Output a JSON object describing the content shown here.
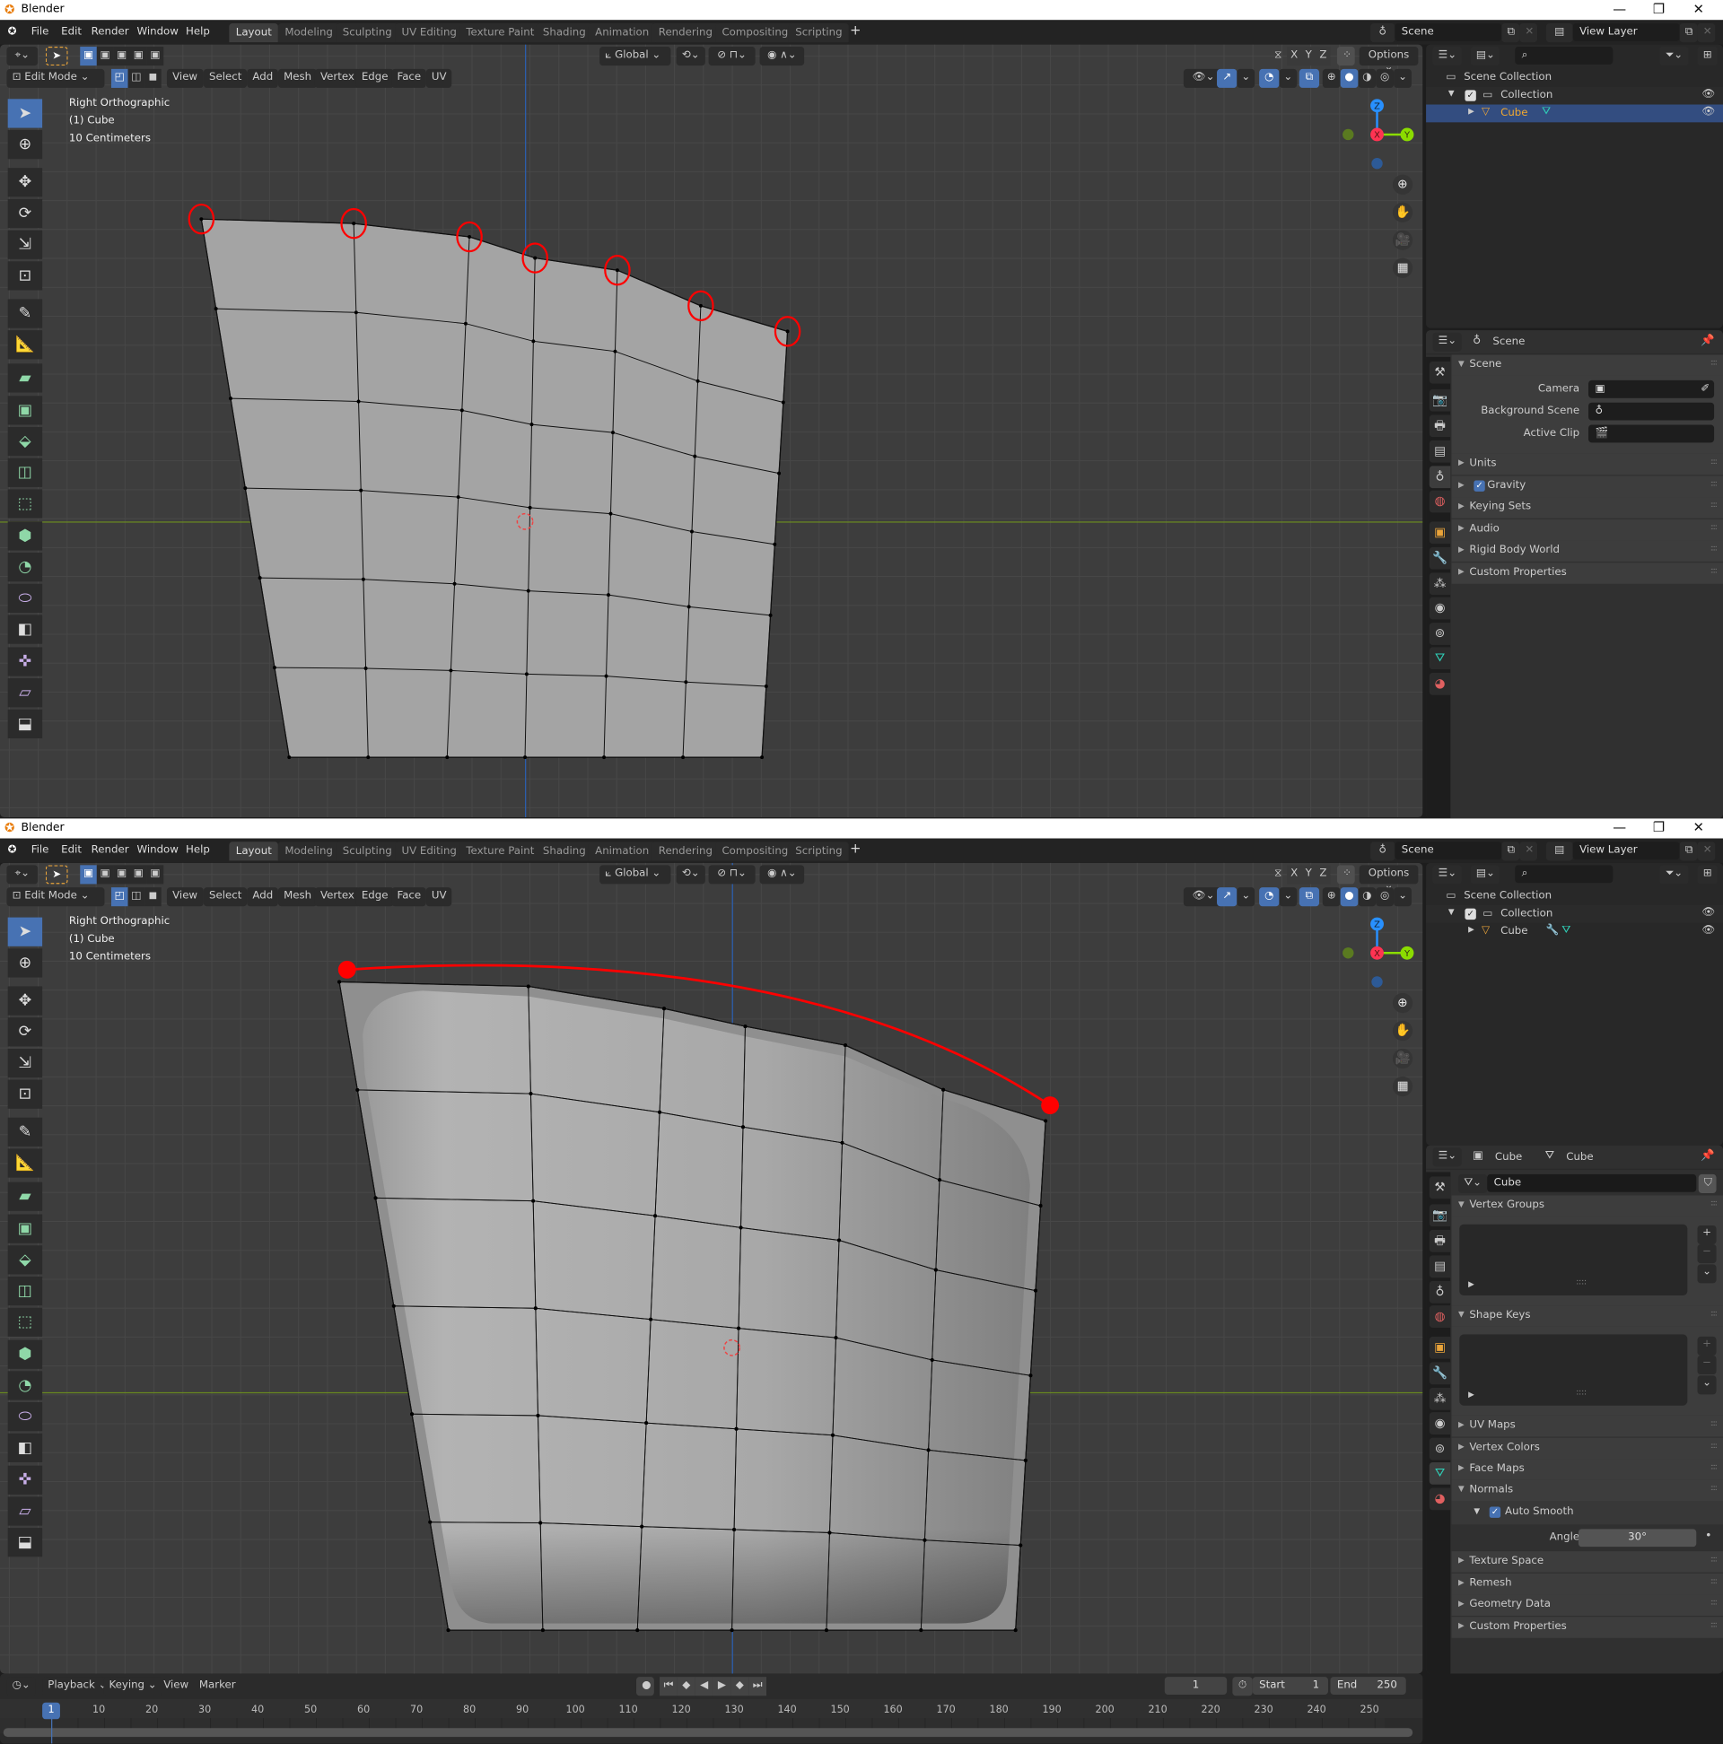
{
  "app": {
    "title": "Blender",
    "logo": "blender-logo"
  },
  "menus": [
    "File",
    "Edit",
    "Render",
    "Window",
    "Help"
  ],
  "workspaces": [
    "Layout",
    "Modeling",
    "Sculpting",
    "UV Editing",
    "Texture Paint",
    "Shading",
    "Animation",
    "Rendering",
    "Compositing",
    "Scripting"
  ],
  "active_workspace": "Layout",
  "scene_name": "Scene",
  "view_layer": "View Layer",
  "tool_header": {
    "orientation": "Global",
    "axes": [
      "X",
      "Y",
      "Z"
    ],
    "options": "Options"
  },
  "edit_header": {
    "mode": "Edit Mode",
    "menus": [
      "View",
      "Select",
      "Add",
      "Mesh",
      "Vertex",
      "Edge",
      "Face",
      "UV"
    ]
  },
  "viewport": {
    "view": "Right Orthographic",
    "object": "(1) Cube",
    "scale": "10 Centimeters"
  },
  "gizmo": {
    "z": "Z",
    "x": "X",
    "y": "Y"
  },
  "outliner": {
    "root": "Scene Collection",
    "collection": "Collection",
    "object": "Cube"
  },
  "colors": {
    "accent": "#4772b3",
    "annotation": "#ff0000",
    "object": "#e8a33a",
    "x_axis": "#ff3352",
    "y_axis": "#8bdc00",
    "z_axis": "#2890ff"
  },
  "windows": [
    {
      "properties": {
        "header": "Scene",
        "panel": "Scene",
        "fields": [
          {
            "label": "Camera"
          },
          {
            "label": "Background Scene"
          },
          {
            "label": "Active Clip"
          }
        ],
        "collapsed": [
          "Units",
          "Gravity",
          "Keying Sets",
          "Audio",
          "Rigid Body World",
          "Custom Properties"
        ],
        "gravity_checked": true
      },
      "annotation": "circled-vertices"
    },
    {
      "properties": {
        "header_object": "Cube",
        "header_mesh": "Cube",
        "datablock": "Cube",
        "vertex_groups": "Vertex Groups",
        "shape_keys": "Shape Keys",
        "collapsed": [
          "UV Maps",
          "Vertex Colors",
          "Face Maps"
        ],
        "normals": "Normals",
        "auto_smooth": "Auto Smooth",
        "auto_smooth_checked": true,
        "angle_label": "Angle",
        "angle_value": "30°",
        "collapsed2": [
          "Texture Space",
          "Remesh",
          "Geometry Data",
          "Custom Properties"
        ]
      },
      "annotation": "arc-between-vertices"
    }
  ],
  "timeline": {
    "menus": [
      "Playback",
      "Keying",
      "View",
      "Marker"
    ],
    "current_frame": "1",
    "start_label": "Start",
    "start": "1",
    "end_label": "End",
    "end": "250",
    "ticks": [
      "1",
      "10",
      "20",
      "30",
      "40",
      "50",
      "60",
      "70",
      "80",
      "90",
      "100",
      "110",
      "120",
      "130",
      "140",
      "150",
      "160",
      "170",
      "180",
      "190",
      "200",
      "210",
      "220",
      "230",
      "240",
      "250"
    ]
  }
}
